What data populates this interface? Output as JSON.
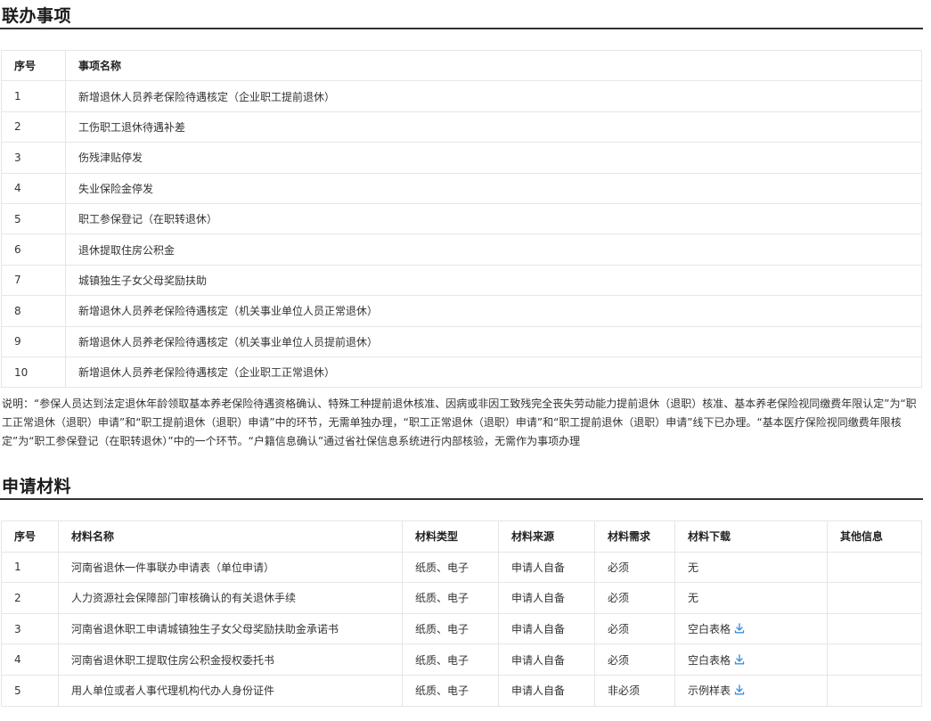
{
  "section1": {
    "title": "联办事项",
    "table": {
      "headers": [
        "序号",
        "事项名称"
      ],
      "rows": [
        [
          "1",
          "新增退休人员养老保险待遇核定（企业职工提前退休）"
        ],
        [
          "2",
          "工伤职工退休待遇补差"
        ],
        [
          "3",
          "伤残津贴停发"
        ],
        [
          "4",
          "失业保险金停发"
        ],
        [
          "5",
          "职工参保登记（在职转退休）"
        ],
        [
          "6",
          "退休提取住房公积金"
        ],
        [
          "7",
          "城镇独生子女父母奖励扶助"
        ],
        [
          "8",
          "新增退休人员养老保险待遇核定（机关事业单位人员正常退休）"
        ],
        [
          "9",
          "新增退休人员养老保险待遇核定（机关事业单位人员提前退休）"
        ],
        [
          "10",
          "新增退休人员养老保险待遇核定（企业职工正常退休）"
        ]
      ]
    },
    "note": "说明：“参保人员达到法定退休年龄领取基本养老保险待遇资格确认、特殊工种提前退休核准、因病或非因工致残完全丧失劳动能力提前退休（退职）核准、基本养老保险视同缴费年限认定”为“职工正常退休（退职）申请”和“职工提前退休（退职）申请”中的环节，无需单独办理，“职工正常退休（退职）申请”和“职工提前退休（退职）申请”线下已办理。“基本医疗保险视同缴费年限核定”为“职工参保登记（在职转退休）”中的一个环节。“户籍信息确认”通过省社保信息系统进行内部核验，无需作为事项办理"
  },
  "section2": {
    "title": "申请材料",
    "table": {
      "headers": [
        "序号",
        "材料名称",
        "材料类型",
        "材料来源",
        "材料需求",
        "材料下载",
        "其他信息"
      ],
      "rows": [
        {
          "no": "1",
          "name": "河南省退休一件事联办申请表（单位申请）",
          "type": "纸质、电子",
          "source": "申请人自备",
          "need": "必须",
          "download": "无",
          "download_icon": "",
          "other": ""
        },
        {
          "no": "2",
          "name": "人力资源社会保障部门审核确认的有关退休手续",
          "type": "纸质、电子",
          "source": "申请人自备",
          "need": "必须",
          "download": "无",
          "download_icon": "",
          "other": ""
        },
        {
          "no": "3",
          "name": "河南省退休职工申请城镇独生子女父母奖励扶助金承诺书",
          "type": "纸质、电子",
          "source": "申请人自备",
          "need": "必须",
          "download": "空白表格",
          "download_icon": "download-icon",
          "other": ""
        },
        {
          "no": "4",
          "name": "河南省退休职工提取住房公积金授权委托书",
          "type": "纸质、电子",
          "source": "申请人自备",
          "need": "必须",
          "download": "空白表格",
          "download_icon": "download-icon",
          "other": ""
        },
        {
          "no": "5",
          "name": "用人单位或者人事代理机构代办人身份证件",
          "type": "纸质、电子",
          "source": "申请人自备",
          "need": "非必须",
          "download": "示例样表",
          "download_icon": "download-icon",
          "other": ""
        }
      ]
    }
  },
  "colors": {
    "icon_blue": "#3b8fe0",
    "border": "#e6e6e6",
    "rule": "#333333"
  }
}
